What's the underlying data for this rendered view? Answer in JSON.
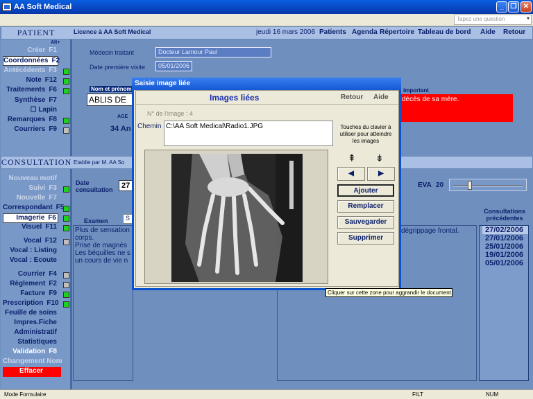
{
  "window": {
    "title": "AA Soft Medical",
    "minimize": "_",
    "restore": "❐",
    "close": "✕"
  },
  "menubar": {
    "search_placeholder": "Tapez une question"
  },
  "top": {
    "licence": "Licence à  AA Soft Medical",
    "date": "jeudi 16 mars 2006",
    "nav": [
      "Patients",
      "Agenda",
      "Répertoire",
      "Tableau de bord",
      "Aide",
      "Retour"
    ]
  },
  "patient": {
    "header": "PATIENT",
    "alt_hint": "Alt+",
    "items": [
      {
        "label": "Créer",
        "key": "F1",
        "state": "dim"
      },
      {
        "label": "Coordonnées",
        "key": "F2",
        "state": "sel"
      },
      {
        "label": "Antécédents",
        "key": "F3",
        "state": "dim",
        "ind": "on"
      },
      {
        "label": "Note",
        "key": "F12",
        "state": "",
        "ind": "on"
      },
      {
        "label": "Traitements",
        "key": "F6",
        "state": "",
        "ind": "on"
      },
      {
        "label": "Synthèse",
        "key": "F7",
        "state": ""
      },
      {
        "label": "☐ Lapin",
        "key": "",
        "state": ""
      },
      {
        "label": "Remarques",
        "key": "F8",
        "state": "",
        "ind": "on"
      },
      {
        "label": "Courriers",
        "key": "F9",
        "state": "",
        "ind": "off"
      }
    ],
    "medecin_label": "Médecin traitant",
    "medecin_value": "Docteur Lamour Paul",
    "visite_label": "Date première visite",
    "visite_value": "05/01/2006",
    "nom_label": "Nom et prénom",
    "nom_value": "ABLIS DE N",
    "age_label": "AGE",
    "age_value": "34 An",
    "important_label": "important",
    "important_value": "décès de sa mère."
  },
  "consultation": {
    "header": "CONSULTATION",
    "etablie": "Etablie par M.  AA So",
    "items": [
      {
        "label": "Nouveau motif",
        "key": "",
        "state": "dim"
      },
      {
        "label": "Suivi",
        "key": "F3",
        "state": "dim",
        "ind": "on"
      },
      {
        "label": "Nouvelle",
        "key": "F7",
        "state": "dim"
      },
      {
        "label": "Correspondant",
        "key": "F5",
        "state": "",
        "ind": "on"
      },
      {
        "label": "Imagerie",
        "key": "F6",
        "state": "sel",
        "ind": "on"
      },
      {
        "label": "Visuel",
        "key": "F11",
        "state": "",
        "ind": "on"
      },
      {
        "label": "Vocal",
        "key": "F12",
        "state": "",
        "ind": "off"
      },
      {
        "label": "Vocal : Listing",
        "key": "",
        "state": ""
      },
      {
        "label": "Vocal : Ecoute",
        "key": "",
        "state": ""
      },
      {
        "label": "Courrier",
        "key": "F4",
        "state": "",
        "ind": "off"
      },
      {
        "label": "Règlement",
        "key": "F2",
        "state": "",
        "ind": "off"
      },
      {
        "label": "Facture",
        "key": "F9",
        "state": "",
        "ind": "on"
      },
      {
        "label": "Prescription",
        "key": "F10",
        "state": "",
        "ind": "on"
      },
      {
        "label": "Feuille de soins",
        "key": "",
        "state": ""
      },
      {
        "label": "Impres.Fiche",
        "key": "",
        "state": ""
      },
      {
        "label": "Administratif",
        "key": "",
        "state": ""
      },
      {
        "label": "Statistiques",
        "key": "",
        "state": ""
      },
      {
        "label": "Validation",
        "key": "F8",
        "state": "white"
      },
      {
        "label": "Changement Nom",
        "key": "",
        "state": "dim"
      },
      {
        "label": "Effacer",
        "key": "",
        "state": "red"
      }
    ],
    "date_label": "Date consultation",
    "date_value": "27",
    "eva_label": "EVA",
    "eva_value": "20",
    "examen_label": "Examen",
    "examen_tab": "S",
    "notes": [
      "Plus de sensation",
      "corps.",
      "Prise de magnés",
      "Les béquilles ne s",
      "un cours de vie n"
    ],
    "right_note": "dégrippage frontal.",
    "prev_label": "Consultations précédentes",
    "previous": [
      "27/02/2006",
      "27/01/2006",
      "25/01/2006",
      "19/01/2006",
      "05/01/2006"
    ]
  },
  "dialog": {
    "title": "Saisie image liée",
    "heading": "Images liées",
    "retour": "Retour",
    "aide": "Aide",
    "image_no": "N° de l'image :  4",
    "chemin_label": "Chemin",
    "chemin_value": "C:\\AA Soft Medical\\Radio1.JPG",
    "keys_hint": "Touches du clavier à utiliser pour atteindre les images",
    "buttons": [
      "Ajouter",
      "Remplacer",
      "Sauvegarder",
      "Supprimer"
    ]
  },
  "tooltip": "Cliquer sur cette zone pour aggrandir le document",
  "status": {
    "mode": "Mode Formulaire",
    "filt": "FILT",
    "num": "NUM"
  }
}
